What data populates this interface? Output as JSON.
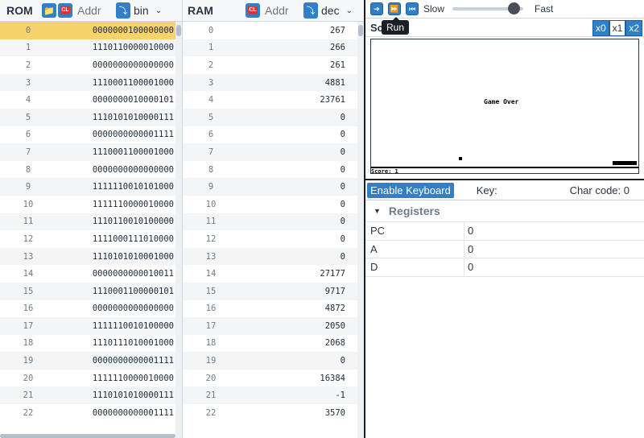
{
  "rom": {
    "title": "ROM",
    "addr_placeholder": "Addr",
    "format": "bin",
    "rows": [
      {
        "i": "0",
        "v": "0000000100000000"
      },
      {
        "i": "1",
        "v": "1110110000010000"
      },
      {
        "i": "2",
        "v": "0000000000000000"
      },
      {
        "i": "3",
        "v": "1110001100001000"
      },
      {
        "i": "4",
        "v": "0000000010000101"
      },
      {
        "i": "5",
        "v": "1110101010000111"
      },
      {
        "i": "6",
        "v": "0000000000001111"
      },
      {
        "i": "7",
        "v": "1110001100001000"
      },
      {
        "i": "8",
        "v": "0000000000000000"
      },
      {
        "i": "9",
        "v": "1111110010101000"
      },
      {
        "i": "10",
        "v": "1111110000010000"
      },
      {
        "i": "11",
        "v": "1110110010100000"
      },
      {
        "i": "12",
        "v": "1111000111010000"
      },
      {
        "i": "13",
        "v": "1110101010001000"
      },
      {
        "i": "14",
        "v": "0000000000010011"
      },
      {
        "i": "15",
        "v": "1110001100000101"
      },
      {
        "i": "16",
        "v": "0000000000000000"
      },
      {
        "i": "17",
        "v": "1111110010100000"
      },
      {
        "i": "18",
        "v": "1110111010001000"
      },
      {
        "i": "19",
        "v": "0000000000001111"
      },
      {
        "i": "20",
        "v": "1111110000010000"
      },
      {
        "i": "21",
        "v": "1110101010000111"
      },
      {
        "i": "22",
        "v": "0000000000001111"
      }
    ]
  },
  "ram": {
    "title": "RAM",
    "addr_placeholder": "Addr",
    "format": "dec",
    "rows": [
      {
        "i": "0",
        "v": "267"
      },
      {
        "i": "1",
        "v": "266"
      },
      {
        "i": "2",
        "v": "261"
      },
      {
        "i": "3",
        "v": "4881"
      },
      {
        "i": "4",
        "v": "23761"
      },
      {
        "i": "5",
        "v": "0"
      },
      {
        "i": "6",
        "v": "0"
      },
      {
        "i": "7",
        "v": "0"
      },
      {
        "i": "8",
        "v": "0"
      },
      {
        "i": "9",
        "v": "0"
      },
      {
        "i": "10",
        "v": "0"
      },
      {
        "i": "11",
        "v": "0"
      },
      {
        "i": "12",
        "v": "0"
      },
      {
        "i": "13",
        "v": "0"
      },
      {
        "i": "14",
        "v": "27177"
      },
      {
        "i": "15",
        "v": "9717"
      },
      {
        "i": "16",
        "v": "4872"
      },
      {
        "i": "17",
        "v": "2050"
      },
      {
        "i": "18",
        "v": "2068"
      },
      {
        "i": "19",
        "v": "0"
      },
      {
        "i": "20",
        "v": "16384"
      },
      {
        "i": "21",
        "v": "-1"
      },
      {
        "i": "22",
        "v": "3570"
      }
    ]
  },
  "toolbar": {
    "slow_label": "Slow",
    "fast_label": "Fast",
    "tooltip": "Run",
    "speed_fraction": 0.87
  },
  "screen": {
    "title": "Sc",
    "zoom": [
      "x0",
      "x1",
      "x2"
    ],
    "active_zoom": "x1",
    "game_over": "Game Over",
    "score": "Score: 1"
  },
  "keyboard": {
    "button": "Enable Keyboard",
    "key_label": "Key:",
    "char_label": "Char code: 0"
  },
  "registers": {
    "title": "Registers",
    "rows": [
      {
        "name": "PC",
        "value": "0"
      },
      {
        "name": "A",
        "value": "0"
      },
      {
        "name": "D",
        "value": "0"
      }
    ]
  },
  "colors": {
    "accent": "#2f80c8",
    "highlight": "#f7d36b",
    "clear_red": "#e0332b"
  }
}
